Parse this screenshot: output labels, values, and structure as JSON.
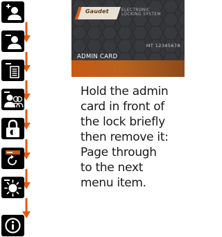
{
  "colors": {
    "icon_bg": "#000000",
    "arrow": "#e25a14",
    "card_bg": "#3a3b3d",
    "card_accent": "#c65a14"
  },
  "menu_icons": [
    {
      "icon": "add-user-icon"
    },
    {
      "icon": "remove-user-icon"
    },
    {
      "icon": "list-icon"
    },
    {
      "icon": "user-group-icon"
    },
    {
      "icon": "padlock-icon"
    },
    {
      "icon": "card-refresh-icon"
    },
    {
      "icon": "sun-icon"
    },
    {
      "icon": "info-icon"
    }
  ],
  "card": {
    "logo": "Gaudet",
    "subtitle_line1": "ELECTRONIC",
    "subtitle_line2": "LOCKING SYSTEM",
    "number": "MT 12345678",
    "title": "ADMIN CARD"
  },
  "instructions": {
    "lines": [
      "Hold the admin",
      "card in front of",
      "the lock briefly",
      "then remove it:",
      "Page through",
      "to the next",
      "menu item."
    ]
  }
}
